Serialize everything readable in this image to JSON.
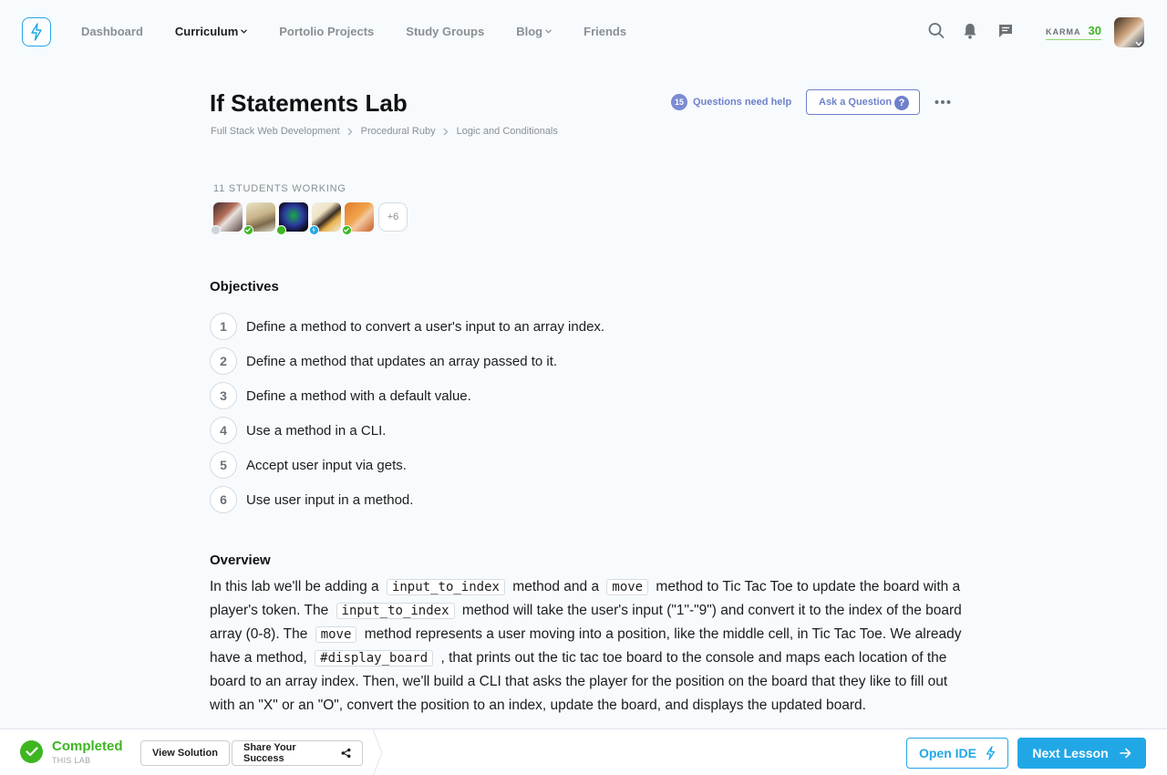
{
  "nav": {
    "links": [
      {
        "label": "Dashboard",
        "active": false,
        "dropdown": false
      },
      {
        "label": "Curriculum",
        "active": true,
        "dropdown": true
      },
      {
        "label": "Portolio Projects",
        "active": false,
        "dropdown": false
      },
      {
        "label": "Study Groups",
        "active": false,
        "dropdown": false
      },
      {
        "label": "Blog",
        "active": false,
        "dropdown": true
      },
      {
        "label": "Friends",
        "active": false,
        "dropdown": false
      }
    ],
    "icons": [
      "search-icon",
      "bell-icon",
      "chat-icon"
    ],
    "karma_label": "KARMA",
    "karma_value": "30"
  },
  "header": {
    "title": "If Statements Lab",
    "help_count": "15",
    "help_label": "Questions need help",
    "ask_button": "Ask a Question",
    "ask_icon": "?",
    "breadcrumb": [
      "Full Stack Web Development",
      "Procedural Ruby",
      "Logic and Conditionals"
    ]
  },
  "students": {
    "label": "11 STUDENTS WORKING",
    "more": "+6",
    "avatars": [
      {
        "status": "offline",
        "status_color": "#cfd3d7"
      },
      {
        "status": "completed",
        "status_color": "#3db620"
      },
      {
        "status": "online",
        "status_color": "#3db620"
      },
      {
        "status": "working",
        "status_color": "#22a7e6"
      },
      {
        "status": "completed",
        "status_color": "#3db620"
      }
    ]
  },
  "objectives": {
    "title": "Objectives",
    "items": [
      {
        "num": "1",
        "text": "Define a method to convert a user's input to an array index."
      },
      {
        "num": "2",
        "text": "Define a method that updates an array passed to it."
      },
      {
        "num": "3",
        "text": "Define a method with a default value."
      },
      {
        "num": "4",
        "text": "Use a method in a CLI."
      },
      {
        "num": "5",
        "text": "Accept user input via gets."
      },
      {
        "num": "6",
        "text": "Use user input in a method."
      }
    ]
  },
  "overview": {
    "title": "Overview",
    "t1": "In this lab we'll be adding a",
    "c1": "input_to_index",
    "t2": "method and a",
    "c2": "move",
    "t3": "method to Tic Tac Toe to update the board with a player's token. The",
    "c3": "input_to_index",
    "t4": "method will take the user's input (\"1\"-\"9\") and convert it to the index of the board array (0-8). The",
    "c4": "move",
    "t5": "method represents a user moving into a position, like the middle cell, in Tic Tac Toe. We already have a method,",
    "c5": "#display_board",
    "t6": ",  that prints out the tic tac toe board to the console and maps each location of the board to an array index. Then, we'll build a CLI that asks the player for the position on the board that they like to fill out with an \"X\" or an \"O\", convert the position to an index, update the board, and displays the updated board."
  },
  "footer": {
    "status": "Completed",
    "status_sub": "THIS LAB",
    "view_solution": "View Solution",
    "share": "Share Your Success",
    "open_ide": "Open IDE",
    "next_lesson": "Next Lesson"
  },
  "colors": {
    "accent": "#22a7e6",
    "success": "#3db620",
    "help": "#6f80cc"
  }
}
